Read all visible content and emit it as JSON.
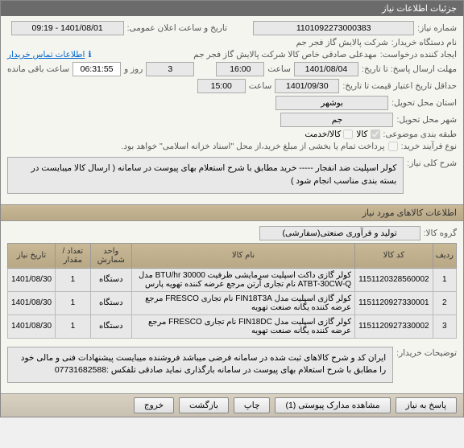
{
  "panel_title": "جزئیات اطلاعات نیاز",
  "fields": {
    "need_number_label": "شماره نیاز:",
    "need_number": "1101092273000383",
    "announce_label": "تاریخ و ساعت اعلان عمومی:",
    "announce_value": "1401/08/01 - 09:19",
    "buyer_label": "نام دستگاه خریدار:",
    "buyer": "شرکت پالایش گاز فجر جم",
    "requester_label": "ایجاد کننده درخواست:",
    "requester": "مهدعلی صادقی خاص کالا شرکت پالایش گاز فجر جم",
    "contact_link": "اطلاعات تماس خریدار",
    "deadline_label": "مهلت ارسال پاسخ: تا تاریخ:",
    "deadline_date": "1401/08/04",
    "time_label": "ساعت",
    "deadline_time": "16:00",
    "days_label": "روز و",
    "days": "3",
    "remaining_label": "ساعت باقی مانده",
    "remaining_time": "06:31:55",
    "validity_label": "حداقل تاریخ اعتبار قیمت تا تاریخ:",
    "validity_date": "1401/09/30",
    "validity_time": "15:00",
    "province_label": "استان محل تحویل:",
    "province": "بوشهر",
    "city_label": "شهر محل تحویل:",
    "city": "جم",
    "classification_label": "طبقه بندی موضوعی:",
    "chk_goods": "کالا",
    "chk_service": "کالا/خدمت",
    "purchase_type_label": "نوع فرآیند خرید:",
    "purchase_type_note": "پرداخت تمام یا بخشی از مبلغ خرید،از محل \"اسناد خزانه اسلامی\" خواهد بود.",
    "desc_label": "شرح کلی نیاز:",
    "desc_text": "کولر اسپلیت ضد انفجار ----- خرید مطابق با شرح استعلام بهای پیوست در سامانه ( ارسال کالا میبایست در بسته بندی مناسب انجام شود )"
  },
  "goods_header": "اطلاعات کالاهای مورد نیاز",
  "group_label": "گروه کالا:",
  "group_value": "تولید و فرآوری صنعتی(سفارشی)",
  "table": {
    "headers": [
      "ردیف",
      "کد کالا",
      "نام کالا",
      "واحد شمارش",
      "تعداد / مقدار",
      "تاریخ نیاز"
    ],
    "rows": [
      {
        "n": "1",
        "code": "1151120328560002",
        "name": "کولر گازی داکت اسپلیت سرمایشی ظرفیت BTU/hr 30000 مدل ATBT-30CW-Q نام تجاری آرتن مرجع عرضه کننده تهویه پارس",
        "unit": "دستگاه",
        "qty": "1",
        "date": "1401/08/30"
      },
      {
        "n": "2",
        "code": "1151120927330001",
        "name": "کولر گازی اسپلیت مدل FIN18T3A نام تجاری FRESCO مرجع عرضه کننده یگانه صنعت تهویه",
        "unit": "دستگاه",
        "qty": "1",
        "date": "1401/08/30"
      },
      {
        "n": "3",
        "code": "1151120927330002",
        "name": "کولر گازی اسپلیت مدل FIN18DC نام تجاری FRESCO مرجع عرضه کننده یگانه صنعت تهویه",
        "unit": "دستگاه",
        "qty": "1",
        "date": "1401/08/30"
      }
    ]
  },
  "buyer_notes_label": "توضیحات خریدار:",
  "buyer_notes": "ایران کد و شرح کالاهای ثبت شده در سامانه فرضی میباشد فروشنده میبایست پیشنهادات فنی و مالی خود را مطابق با شرح استعلام بهای پیوست در سامانه بارگذاری نماید       صادقی       تلفکس :07731682588",
  "buttons": {
    "reply": "پاسخ به نیاز",
    "attachments": "مشاهده مدارک پیوستی (1)",
    "print": "چاپ",
    "back": "بازگشت",
    "exit": "خروج"
  }
}
